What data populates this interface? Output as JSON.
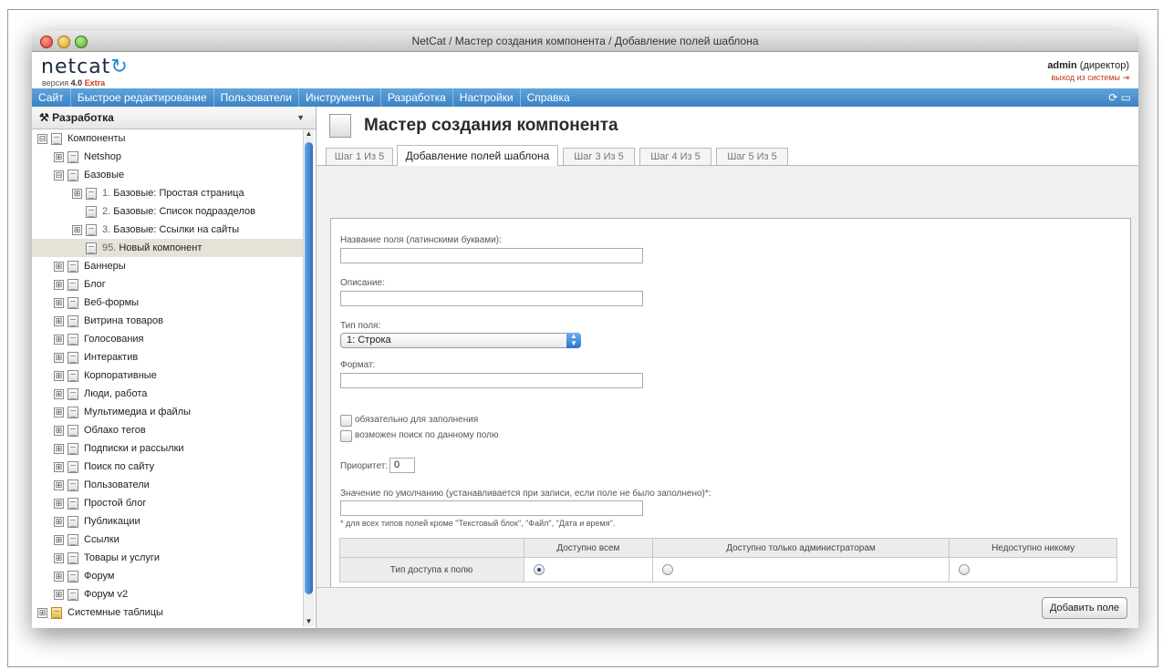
{
  "window": {
    "title": "NetCat / Мастер создания компонента / Добавление полей шаблона"
  },
  "brand": {
    "logo_text": "netcat",
    "version_label": "версия",
    "version_number": "4.0",
    "version_edition": "Extra"
  },
  "user": {
    "name": "admin",
    "role": "(директор)",
    "logout": "выход из системы"
  },
  "menu": {
    "items": [
      "Сайт",
      "Быстрое редактирование",
      "Пользователи",
      "Инструменты",
      "Разработка",
      "Настройки",
      "Справка"
    ],
    "right_icons": [
      "refresh-icon",
      "chat-icon"
    ]
  },
  "sidebar": {
    "title": "Разработка",
    "tree": [
      {
        "label": "Компоненты",
        "toggle": "⊟"
      },
      {
        "label": "Netshop",
        "toggle": "⊞"
      },
      {
        "label": "Базовые",
        "toggle": "⊟"
      },
      {
        "num": "1.",
        "label": "Базовые: Простая страница",
        "toggle": "⊞"
      },
      {
        "num": "2.",
        "label": "Базовые: Список подразделов",
        "toggle": ""
      },
      {
        "num": "3.",
        "label": "Базовые: Ссылки на сайты",
        "toggle": "⊞"
      },
      {
        "num": "95.",
        "label": "Новый компонент",
        "toggle": ""
      },
      {
        "label": "Баннеры",
        "toggle": "⊞"
      },
      {
        "label": "Блог",
        "toggle": "⊞"
      },
      {
        "label": "Веб-формы",
        "toggle": "⊞"
      },
      {
        "label": "Витрина товаров",
        "toggle": "⊞"
      },
      {
        "label": "Голосования",
        "toggle": "⊞"
      },
      {
        "label": "Интерактив",
        "toggle": "⊞"
      },
      {
        "label": "Корпоративные",
        "toggle": "⊞"
      },
      {
        "label": "Люди, работа",
        "toggle": "⊞"
      },
      {
        "label": "Мультимедиа и файлы",
        "toggle": "⊞"
      },
      {
        "label": "Облако тегов",
        "toggle": "⊞"
      },
      {
        "label": "Подписки и рассылки",
        "toggle": "⊞"
      },
      {
        "label": "Поиск по сайту",
        "toggle": "⊞"
      },
      {
        "label": "Пользователи",
        "toggle": "⊞"
      },
      {
        "label": "Простой блог",
        "toggle": "⊞"
      },
      {
        "label": "Публикации",
        "toggle": "⊞"
      },
      {
        "label": "Ссылки",
        "toggle": "⊞"
      },
      {
        "label": "Товары и услуги",
        "toggle": "⊞"
      },
      {
        "label": "Форум",
        "toggle": "⊞"
      },
      {
        "label": "Форум v2",
        "toggle": "⊞"
      },
      {
        "label": "Системные таблицы",
        "toggle": "⊞"
      }
    ]
  },
  "main": {
    "title": "Мастер создания компонента",
    "tabs": [
      "Шаг 1 Из 5",
      "Добавление полей шаблона",
      "Шаг 3 Из 5",
      "Шаг 4 Из 5",
      "Шаг 5 Из 5"
    ],
    "form": {
      "field_name_label": "Название поля (латинскими буквами):",
      "field_name_value": "",
      "description_label": "Описание:",
      "description_value": "",
      "type_label": "Тип поля:",
      "type_value": "1: Строка",
      "format_label": "Формат:",
      "format_value": "",
      "required_label": "обязательно для заполнения",
      "searchable_label": "возможен поиск по данному полю",
      "priority_label": "Приоритет:",
      "priority_value": "0",
      "default_label": "Значение по умолчанию (устанавливается при записи, если поле не было заполнено)*:",
      "default_value": "",
      "default_note": "* для всех типов полей кроме \"Текстовый блок\", \"Файл\", \"Дата и время\"."
    },
    "access": {
      "columns": [
        "Доступно всем",
        "Доступно только администраторам",
        "Недоступно никому"
      ],
      "row_label": "Тип доступа к полю",
      "selected": "Доступно всем"
    },
    "add_button": "Добавить поле"
  }
}
